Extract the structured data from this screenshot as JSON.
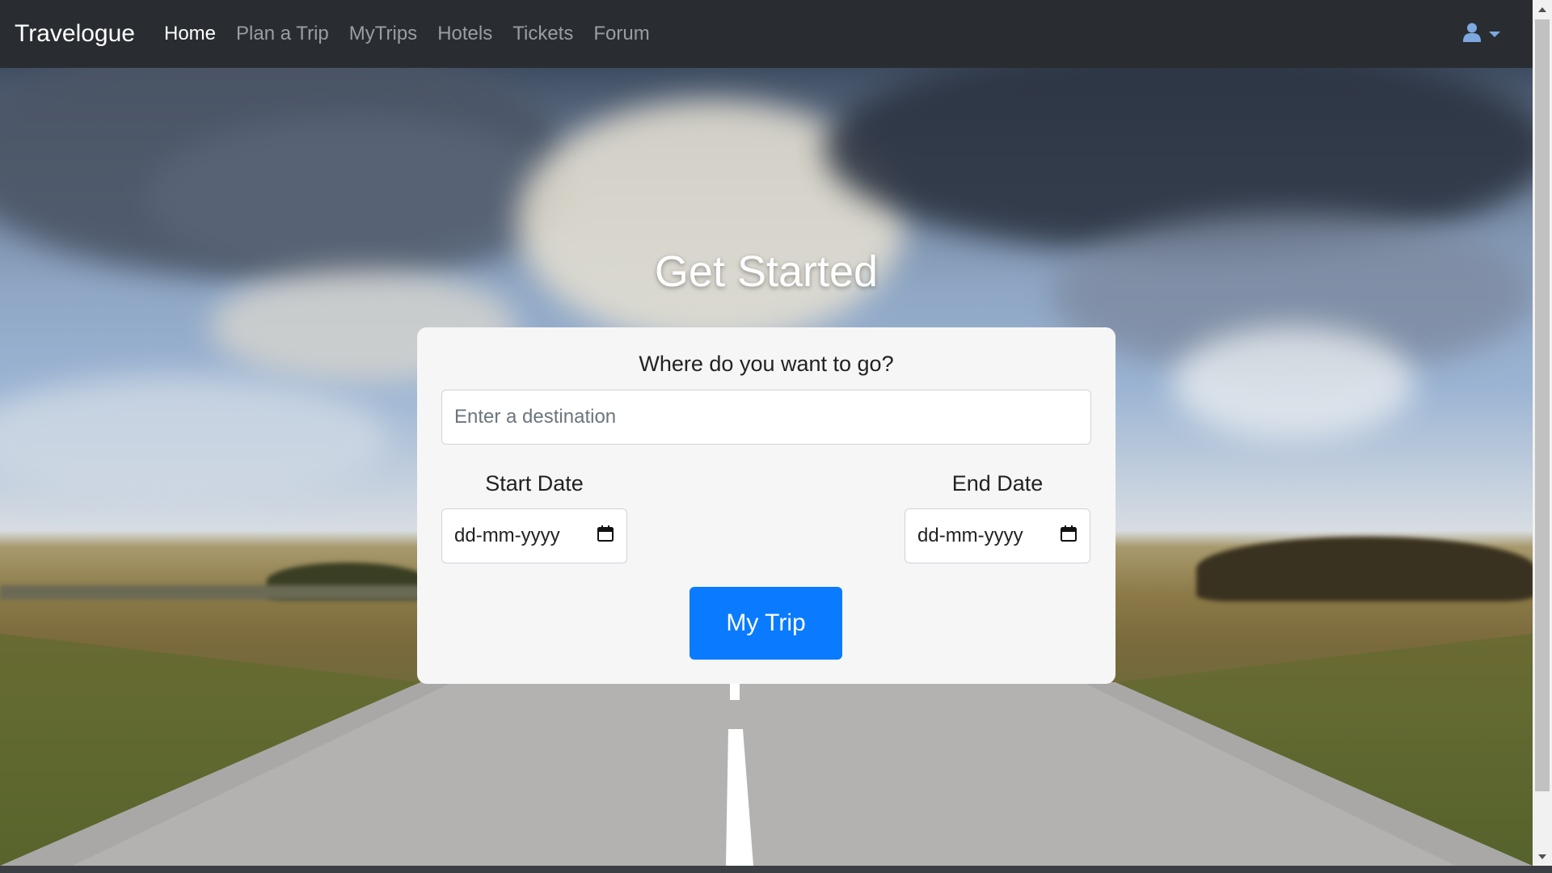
{
  "navbar": {
    "brand": "Travelogue",
    "links": [
      {
        "label": "Home",
        "active": true
      },
      {
        "label": "Plan a Trip",
        "active": false
      },
      {
        "label": "MyTrips",
        "active": false
      },
      {
        "label": "Hotels",
        "active": false
      },
      {
        "label": "Tickets",
        "active": false
      },
      {
        "label": "Forum",
        "active": false
      }
    ],
    "user_icon": "user-icon",
    "dropdown_icon": "caret-down-icon"
  },
  "hero": {
    "title": "Get Started"
  },
  "form": {
    "question": "Where do you want to go?",
    "destination_placeholder": "Enter a destination",
    "destination_value": "",
    "start_label": "Start Date",
    "start_value": "dd-mm-yyyy",
    "end_label": "End Date",
    "end_value": "dd-mm-yyyy",
    "calendar_icon": "calendar-icon",
    "submit_label": "My Trip"
  },
  "colors": {
    "navbar_bg": "#292d31",
    "nav_active": "#ffffff",
    "nav_inactive": "#9a9da1",
    "primary_button": "#0a7bff",
    "user_icon": "#7ea9e0"
  }
}
